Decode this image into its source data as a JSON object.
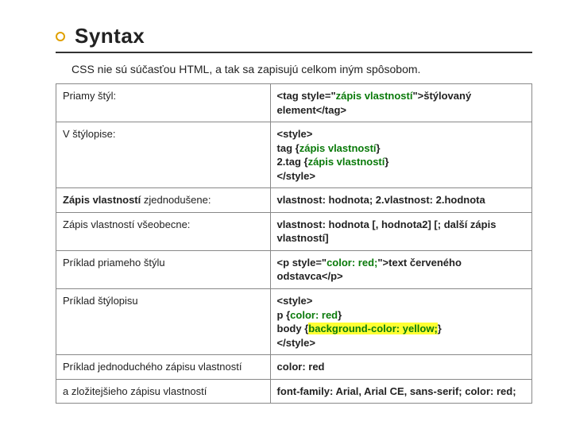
{
  "title": "Syntax",
  "intro": "CSS nie sú súčasťou HTML, a tak sa zapisujú celkom iným spôsobom.",
  "rows": [
    {
      "left": "Priamy štýl:",
      "right_html": "&lt;tag style=&quot;<span class='g'>zápis vlastností</span>&quot;&gt;štýlovaný element&lt;/tag&gt;"
    },
    {
      "left": "V štýlopise:",
      "right_html": "&lt;style&gt;<br>tag {<span class='g'>zápis vlastností</span>}<br>2.tag {<span class='g'>zápis vlastností</span>}<br>&lt;/style&gt;"
    },
    {
      "left": "<b>Zápis vlastností</b> zjednodušene:",
      "right_html": "vlastnost: hodnota; 2.vlastnost: 2.hodnota"
    },
    {
      "left": "Zápis vlastností všeobecne:",
      "right_html": "vlastnost: hodnota [, hodnota2] [; další zápis vlastností]"
    },
    {
      "left": "Príklad priameho štýlu",
      "right_html": "&lt;p style=&quot;<span class='g'>color: red;</span>&quot;&gt;text červeného odstavca&lt;/p&gt;"
    },
    {
      "left": "Príklad štýlopisu",
      "right_html": "&lt;style&gt;<br>p {<span class='g'>color: red</span>}<br>body {<span class='g'><span class='hl'>background-color: yellow;</span></span>}<br>&lt;/style&gt;"
    },
    {
      "left": "Príklad jednoduchého zápisu vlastností",
      "right_html": "color: red"
    },
    {
      "left": "a zložitejšieho zápisu vlastností",
      "right_html": "font-family: Arial, Arial CE, sans-serif; color: red;"
    }
  ]
}
